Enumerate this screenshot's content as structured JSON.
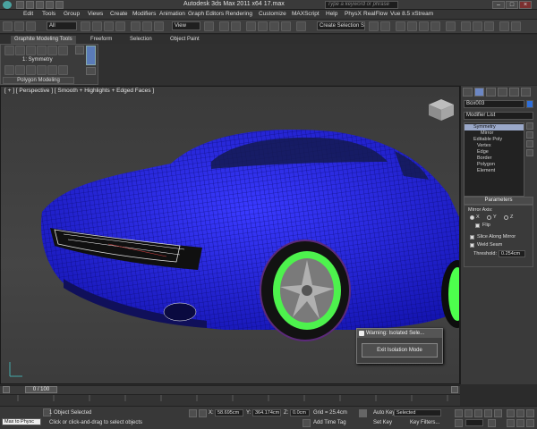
{
  "window": {
    "title": "Autodesk 3ds Max  2011 x64      17.max",
    "search_placeholder": "Type a keyword or phrase"
  },
  "menu": [
    "Edit",
    "Tools",
    "Group",
    "Views",
    "Create",
    "Modifiers",
    "Animation",
    "Graph Editors",
    "Rendering",
    "Customize",
    "MAXScript",
    "Help",
    "PhysX",
    "RealFlow",
    "Vue 8.5 xStream"
  ],
  "toolbar": {
    "filter_value": "All",
    "refcoord_value": "View",
    "selection_set_placeholder": "Create Selection Se"
  },
  "ribbon": {
    "tabs": [
      "Graphite Modeling Tools",
      "Freeform",
      "Selection",
      "Object Paint"
    ],
    "symmetry_label": "1: Symmetry",
    "panel_label": "Polygon Modeling"
  },
  "viewport": {
    "label": "[ + ] [ Perspective ] [ Smooth + Highlights + Edged Faces ]"
  },
  "command_panel": {
    "object_name": "Box003",
    "object_color": "#2f6fd9",
    "modifier_list_label": "Modifier List",
    "stack": [
      "Symmetry",
      "Mirror",
      "Editable Poly",
      "Vertex",
      "Edge",
      "Border",
      "Polygon",
      "Element"
    ],
    "parameters_title": "Parameters",
    "mirror_axis_label": "Mirror Axis:",
    "axes": [
      "X",
      "Y",
      "Z"
    ],
    "flip_label": "Flip",
    "slice_label": "Slice Along Mirror",
    "weld_label": "Weld Seam",
    "threshold_label": "Threshold:",
    "threshold_value": "0.254cm"
  },
  "dialog": {
    "title": "Warning: Isolated Sele...",
    "button_label": "Exit Isolation Mode"
  },
  "timeline": {
    "frame_label": "0 / 100"
  },
  "status": {
    "maxscript_label": "Max to Physc",
    "selected": "1 Object Selected",
    "prompt": "Click or click-and-drag to select objects",
    "x_label": "X:",
    "x_value": "58.695cm",
    "y_label": "Y:",
    "y_value": "364.174cm",
    "z_label": "Z:",
    "z_value": "0.0cm",
    "grid": "Grid = 25.4cm",
    "add_time_tag": "Add Time Tag",
    "auto_key": "Auto Key",
    "auto_key_value": "Selected",
    "set_key": "Set Key",
    "key_filters": "Key Filters..."
  }
}
